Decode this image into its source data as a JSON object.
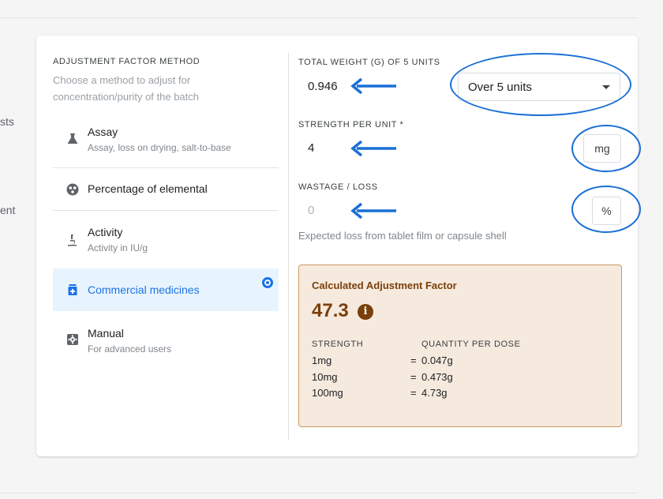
{
  "background_fragments": [
    "sts",
    "ent"
  ],
  "left_panel": {
    "heading": "ADJUSTMENT FACTOR METHOD",
    "subtitle": "Choose a method to adjust for concentration/purity of the batch",
    "methods": [
      {
        "title": "Assay",
        "subtitle": "Assay, loss on drying, salt-to-base",
        "icon": "flask-icon",
        "selected": false
      },
      {
        "title": "Percentage of elemental",
        "subtitle": "",
        "icon": "molecule-icon",
        "selected": false
      },
      {
        "title": "Activity",
        "subtitle": "Activity in IU/g",
        "icon": "microscope-icon",
        "selected": false
      },
      {
        "title": "Commercial medicines",
        "subtitle": "",
        "icon": "medicine-bottle-icon",
        "selected": true
      },
      {
        "title": "Manual",
        "subtitle": "For advanced users",
        "icon": "gear-icon",
        "selected": false
      }
    ]
  },
  "form": {
    "total_weight": {
      "label": "TOTAL WEIGHT (G) OF 5 UNITS",
      "value": "0.946",
      "select_value": "Over 5 units"
    },
    "strength": {
      "label": "STRENGTH PER UNIT *",
      "value": "4",
      "unit": "mg"
    },
    "wastage": {
      "label": "WASTAGE / LOSS",
      "placeholder": "0",
      "unit": "%",
      "hint": "Expected loss from tablet film or capsule shell"
    }
  },
  "result": {
    "title": "Calculated Adjustment Factor",
    "value": "47.3",
    "info_icon": "i",
    "col_strength": "STRENGTH",
    "col_quantity": "QUANTITY PER DOSE",
    "rows": [
      {
        "strength": "1mg",
        "eq": "=",
        "quantity": "0.047g"
      },
      {
        "strength": "10mg",
        "eq": "=",
        "quantity": "0.473g"
      },
      {
        "strength": "100mg",
        "eq": "=",
        "quantity": "4.73g"
      }
    ]
  },
  "colors": {
    "accent": "#1a73e8",
    "annotation_blue": "#1a6fd6",
    "result_bg": "#f6eadf",
    "result_border": "#c99a5b",
    "result_text": "#7a3f0a",
    "selected_bg": "#e8f4fd"
  }
}
